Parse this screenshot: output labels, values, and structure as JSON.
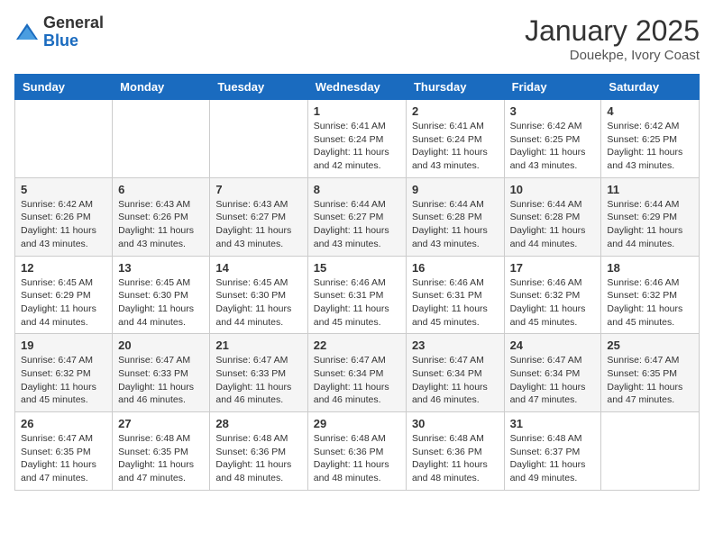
{
  "logo": {
    "general": "General",
    "blue": "Blue"
  },
  "title": "January 2025",
  "subtitle": "Douekpe, Ivory Coast",
  "days_of_week": [
    "Sunday",
    "Monday",
    "Tuesday",
    "Wednesday",
    "Thursday",
    "Friday",
    "Saturday"
  ],
  "weeks": [
    [
      {
        "day": "",
        "info": ""
      },
      {
        "day": "",
        "info": ""
      },
      {
        "day": "",
        "info": ""
      },
      {
        "day": "1",
        "info": "Sunrise: 6:41 AM\nSunset: 6:24 PM\nDaylight: 11 hours and 42 minutes."
      },
      {
        "day": "2",
        "info": "Sunrise: 6:41 AM\nSunset: 6:24 PM\nDaylight: 11 hours and 43 minutes."
      },
      {
        "day": "3",
        "info": "Sunrise: 6:42 AM\nSunset: 6:25 PM\nDaylight: 11 hours and 43 minutes."
      },
      {
        "day": "4",
        "info": "Sunrise: 6:42 AM\nSunset: 6:25 PM\nDaylight: 11 hours and 43 minutes."
      }
    ],
    [
      {
        "day": "5",
        "info": "Sunrise: 6:42 AM\nSunset: 6:26 PM\nDaylight: 11 hours and 43 minutes."
      },
      {
        "day": "6",
        "info": "Sunrise: 6:43 AM\nSunset: 6:26 PM\nDaylight: 11 hours and 43 minutes."
      },
      {
        "day": "7",
        "info": "Sunrise: 6:43 AM\nSunset: 6:27 PM\nDaylight: 11 hours and 43 minutes."
      },
      {
        "day": "8",
        "info": "Sunrise: 6:44 AM\nSunset: 6:27 PM\nDaylight: 11 hours and 43 minutes."
      },
      {
        "day": "9",
        "info": "Sunrise: 6:44 AM\nSunset: 6:28 PM\nDaylight: 11 hours and 43 minutes."
      },
      {
        "day": "10",
        "info": "Sunrise: 6:44 AM\nSunset: 6:28 PM\nDaylight: 11 hours and 44 minutes."
      },
      {
        "day": "11",
        "info": "Sunrise: 6:44 AM\nSunset: 6:29 PM\nDaylight: 11 hours and 44 minutes."
      }
    ],
    [
      {
        "day": "12",
        "info": "Sunrise: 6:45 AM\nSunset: 6:29 PM\nDaylight: 11 hours and 44 minutes."
      },
      {
        "day": "13",
        "info": "Sunrise: 6:45 AM\nSunset: 6:30 PM\nDaylight: 11 hours and 44 minutes."
      },
      {
        "day": "14",
        "info": "Sunrise: 6:45 AM\nSunset: 6:30 PM\nDaylight: 11 hours and 44 minutes."
      },
      {
        "day": "15",
        "info": "Sunrise: 6:46 AM\nSunset: 6:31 PM\nDaylight: 11 hours and 45 minutes."
      },
      {
        "day": "16",
        "info": "Sunrise: 6:46 AM\nSunset: 6:31 PM\nDaylight: 11 hours and 45 minutes."
      },
      {
        "day": "17",
        "info": "Sunrise: 6:46 AM\nSunset: 6:32 PM\nDaylight: 11 hours and 45 minutes."
      },
      {
        "day": "18",
        "info": "Sunrise: 6:46 AM\nSunset: 6:32 PM\nDaylight: 11 hours and 45 minutes."
      }
    ],
    [
      {
        "day": "19",
        "info": "Sunrise: 6:47 AM\nSunset: 6:32 PM\nDaylight: 11 hours and 45 minutes."
      },
      {
        "day": "20",
        "info": "Sunrise: 6:47 AM\nSunset: 6:33 PM\nDaylight: 11 hours and 46 minutes."
      },
      {
        "day": "21",
        "info": "Sunrise: 6:47 AM\nSunset: 6:33 PM\nDaylight: 11 hours and 46 minutes."
      },
      {
        "day": "22",
        "info": "Sunrise: 6:47 AM\nSunset: 6:34 PM\nDaylight: 11 hours and 46 minutes."
      },
      {
        "day": "23",
        "info": "Sunrise: 6:47 AM\nSunset: 6:34 PM\nDaylight: 11 hours and 46 minutes."
      },
      {
        "day": "24",
        "info": "Sunrise: 6:47 AM\nSunset: 6:34 PM\nDaylight: 11 hours and 47 minutes."
      },
      {
        "day": "25",
        "info": "Sunrise: 6:47 AM\nSunset: 6:35 PM\nDaylight: 11 hours and 47 minutes."
      }
    ],
    [
      {
        "day": "26",
        "info": "Sunrise: 6:47 AM\nSunset: 6:35 PM\nDaylight: 11 hours and 47 minutes."
      },
      {
        "day": "27",
        "info": "Sunrise: 6:48 AM\nSunset: 6:35 PM\nDaylight: 11 hours and 47 minutes."
      },
      {
        "day": "28",
        "info": "Sunrise: 6:48 AM\nSunset: 6:36 PM\nDaylight: 11 hours and 48 minutes."
      },
      {
        "day": "29",
        "info": "Sunrise: 6:48 AM\nSunset: 6:36 PM\nDaylight: 11 hours and 48 minutes."
      },
      {
        "day": "30",
        "info": "Sunrise: 6:48 AM\nSunset: 6:36 PM\nDaylight: 11 hours and 48 minutes."
      },
      {
        "day": "31",
        "info": "Sunrise: 6:48 AM\nSunset: 6:37 PM\nDaylight: 11 hours and 49 minutes."
      },
      {
        "day": "",
        "info": ""
      }
    ]
  ]
}
